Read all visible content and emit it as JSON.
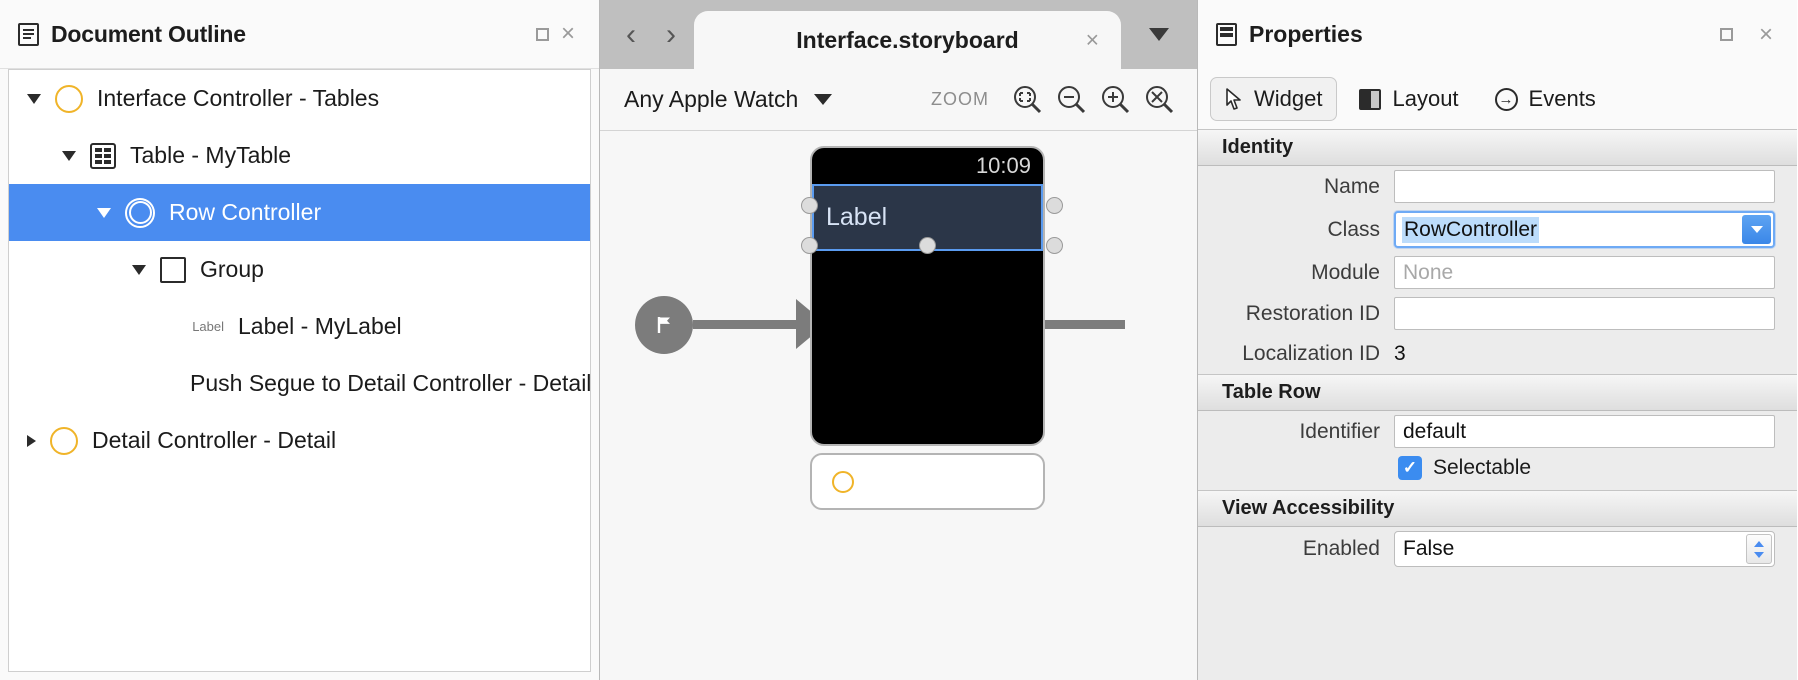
{
  "outline_panel": {
    "title": "Document Outline",
    "icon": "document-outline-icon",
    "minimize_label": "□",
    "close_label": "×",
    "tree": [
      {
        "label": "Interface Controller - Tables",
        "icon": "controller-circle-icon",
        "indent": 0,
        "disclosure": "open",
        "selected": false
      },
      {
        "label": "Table - MyTable",
        "icon": "table-icon",
        "indent": 1,
        "disclosure": "open",
        "selected": false
      },
      {
        "label": "Row Controller",
        "icon": "row-controller-icon",
        "indent": 2,
        "disclosure": "open",
        "selected": true
      },
      {
        "label": "Group",
        "icon": "group-square-icon",
        "indent": 3,
        "disclosure": "open",
        "selected": false
      },
      {
        "label": "Label - MyLabel",
        "icon": "label-text-icon",
        "indent": 4,
        "disclosure": "none",
        "selected": false,
        "icon_text": "Label"
      },
      {
        "label": "Push Segue to Detail Controller - Detail",
        "icon": "none",
        "indent": 4,
        "disclosure": "none",
        "selected": false
      },
      {
        "label": "Detail Controller - Detail",
        "icon": "controller-circle-icon",
        "indent": 0,
        "disclosure": "closed",
        "selected": false
      }
    ]
  },
  "editor": {
    "back_label": "‹",
    "forward_label": "›",
    "tab_title": "Interface.storyboard",
    "tab_close_label": "×",
    "toolbar": {
      "device": "Any Apple Watch",
      "zoom_word": "ZOOM",
      "btn_fit": "zoom-to-fit-icon",
      "btn_out": "zoom-out-icon",
      "btn_in": "zoom-in-icon",
      "btn_actual": "zoom-actual-size-icon"
    },
    "canvas": {
      "status_time": "10:09",
      "label_text": "Label",
      "entry_point": "entry-point-flag-icon"
    }
  },
  "properties": {
    "title": "Properties",
    "minimize_label": "□",
    "close_label": "×",
    "tabs": [
      {
        "label": "Widget",
        "icon": "cursor-arrow-icon",
        "active": true
      },
      {
        "label": "Layout",
        "icon": "layout-panes-icon",
        "active": false
      },
      {
        "label": "Events",
        "icon": "events-arrow-icon",
        "active": false
      }
    ],
    "sections": [
      {
        "header": "Identity",
        "fields": [
          {
            "type": "text",
            "label": "Name",
            "value": "",
            "placeholder": ""
          },
          {
            "type": "combo",
            "label": "Class",
            "value": "RowController"
          },
          {
            "type": "text",
            "label": "Module",
            "value": "",
            "placeholder": "None"
          },
          {
            "type": "text",
            "label": "Restoration ID",
            "value": "",
            "placeholder": ""
          },
          {
            "type": "static",
            "label": "Localization ID",
            "value": "3"
          }
        ]
      },
      {
        "header": "Table Row",
        "fields": [
          {
            "type": "text",
            "label": "Identifier",
            "value": "default",
            "placeholder": ""
          },
          {
            "type": "checkbox",
            "label": "Selectable",
            "checked": true,
            "check_glyph": "✓"
          }
        ]
      },
      {
        "header": "View Accessibility",
        "fields": [
          {
            "type": "stepper",
            "label": "Enabled",
            "value": "False"
          }
        ]
      }
    ]
  },
  "colors": {
    "selection_blue": "#4a8cf0",
    "accent_yellow": "#f0b429",
    "label_fill": "#2b3648",
    "panel_bg": "#ececec"
  }
}
